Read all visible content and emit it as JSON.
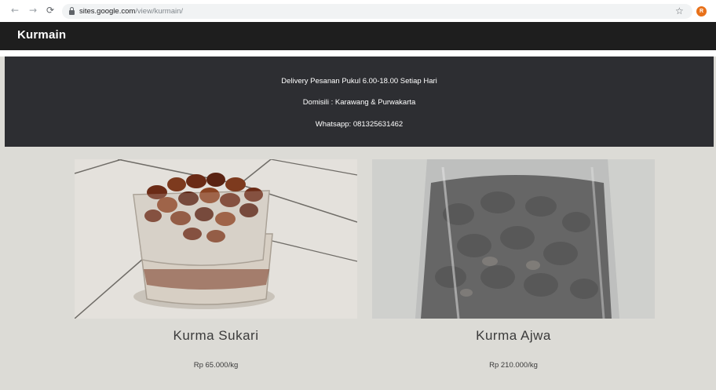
{
  "browser": {
    "url_host": "sites.google.com",
    "url_path": "/view/kurmain/",
    "profile_initial": "R"
  },
  "site": {
    "title": "Kurmain"
  },
  "banner": {
    "line1": "Delivery Pesanan Pukul 6.00-18.00 Setiap Hari",
    "line2": "Domisili : Karawang & Purwakarta",
    "line3": "Whatsapp: 081325631462"
  },
  "products": [
    {
      "name": "Kurma Sukari",
      "price": "Rp 65.000/kg"
    },
    {
      "name": "Kurma Ajwa",
      "price": "Rp 210.000/kg"
    }
  ],
  "colors": {
    "header_bg": "#1e1e1e",
    "banner_bg": "#2d2e32",
    "page_bg": "#dcdbd6"
  }
}
